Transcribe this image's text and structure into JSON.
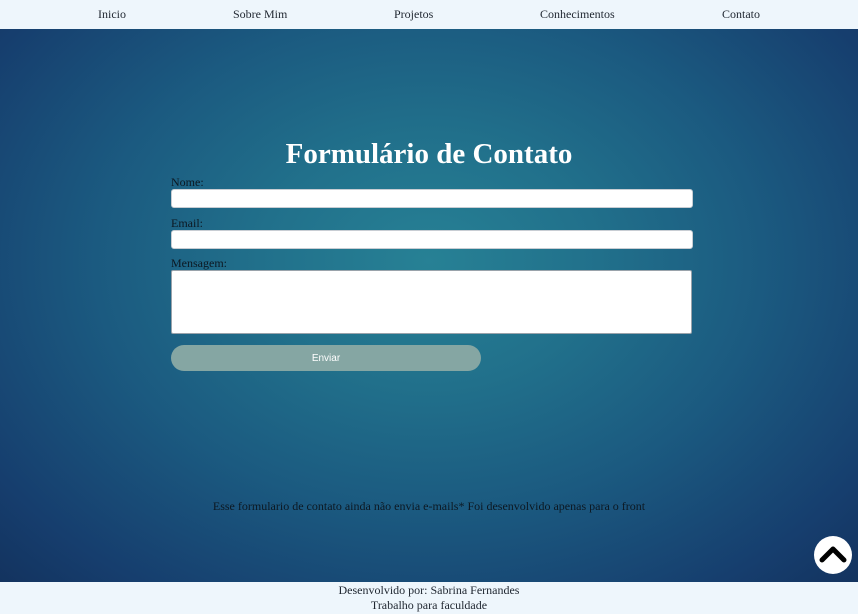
{
  "nav": {
    "items": [
      {
        "label": "Inicio"
      },
      {
        "label": "Sobre Mim"
      },
      {
        "label": "Projetos"
      },
      {
        "label": "Conhecimentos"
      },
      {
        "label": "Contato"
      }
    ]
  },
  "form": {
    "title": "Formulário de Contato",
    "name_label": "Nome:",
    "name_value": "",
    "email_label": "Email:",
    "email_value": "",
    "message_label": "Mensagem:",
    "message_value": "",
    "submit_label": "Enviar"
  },
  "note": "Esse formulario de contato ainda não envia e-mails* Foi desenvolvido apenas para o front",
  "back_to_top": {
    "icon": "chevron-up-icon"
  },
  "footer": {
    "credit": "Desenvolvido por: Sabrina Fernandes",
    "subtitle": "Trabalho para faculdade"
  },
  "colors": {
    "nav_background": "#eef6fc",
    "accent_button": "#85a6a3",
    "background_center": "#278195",
    "background_edge": "#13335f"
  }
}
